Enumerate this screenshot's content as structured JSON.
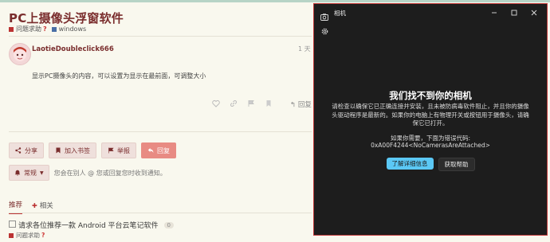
{
  "forum": {
    "title": "PC上摄像头浮窗软件",
    "category": "问题求助",
    "category_qmark": "?",
    "tag": "windows",
    "post": {
      "username": "LaotieDoubleclick666",
      "time": "1 天",
      "content": "显示PC摄像头的内容，可以设置为显示在最前面，可调整大小",
      "reply_label": "回复"
    },
    "buttons": {
      "share": "分享",
      "bookmark": "加入书签",
      "flag": "举报",
      "reply": "回复"
    },
    "notification": {
      "level": "常规",
      "text": "您会在别人 @ 您或回复您时收到通知。"
    },
    "tabs": [
      {
        "label": "推荐"
      },
      {
        "label": "相关"
      }
    ],
    "suggestion": {
      "title": "请求各位推荐一款 Android 平台云笔记软件",
      "count": "0",
      "category": "问题求助",
      "category_qmark": "?"
    }
  },
  "camera": {
    "window_title": "相机",
    "heading": "我们找不到你的相机",
    "body": "请检查以确保它已正确连接并安装，且未被防病毒软件阻止，并且你的摄像头驱动程序是最新的。如果你的电脑上有物理开关或按钮用于摄像头，请确保它已打开。",
    "code_label": "如果你需要，下面为错误代码:",
    "code": "0xA00F4244<NoCamerasAreAttached>",
    "primary_button": "了解详细信息",
    "secondary_button": "获取帮助"
  },
  "colors": {
    "accent": "#7a2d2d",
    "reply_button": "#e88b83",
    "camera_primary": "#5bc8f5",
    "camera_border": "#c03a3a"
  }
}
